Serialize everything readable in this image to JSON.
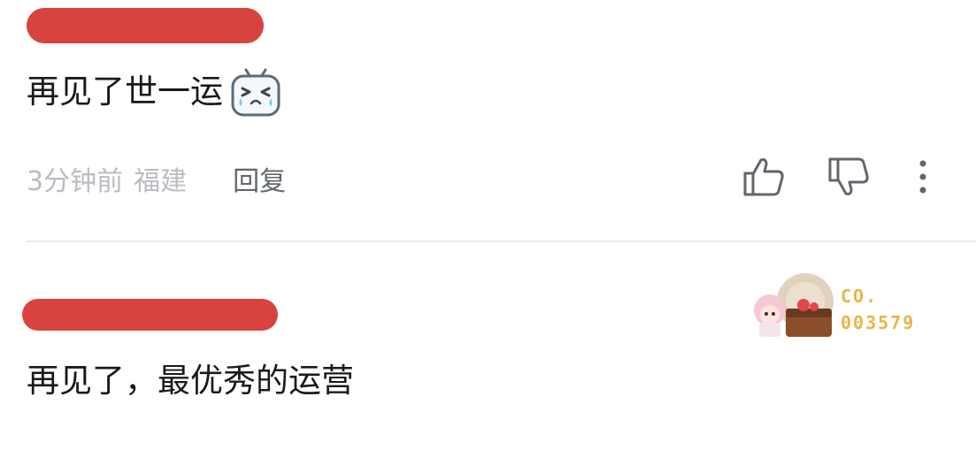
{
  "comments": [
    {
      "username": "",
      "text": "再见了世一运",
      "emoji": "crying-face-emoji",
      "time": "3分钟前",
      "location": "福建",
      "reply_label": "回复"
    },
    {
      "username": "",
      "text": "再见了，最优秀的运营",
      "fan_badge": {
        "line1": "CO.",
        "line2": "003579"
      }
    }
  ],
  "colors": {
    "redaction": "#d9433f",
    "text": "#18191c",
    "meta": "#b9bcc2",
    "reply": "#61666d",
    "badge": "#e8b547"
  }
}
